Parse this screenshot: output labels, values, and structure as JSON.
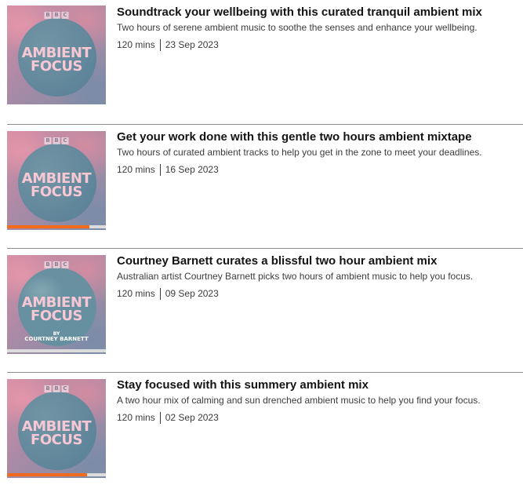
{
  "episodes": [
    {
      "title": "Soundtrack your wellbeing with this curated tranquil ambient mix",
      "description": "Two hours of serene ambient music to soothe the senses and enhance your wellbeing.",
      "duration": "120 mins",
      "date": "23 Sep 2023",
      "art": {
        "logo": [
          "B",
          "B",
          "C"
        ],
        "line1": "AMBIENT",
        "line2": "FOCUS"
      },
      "progress": null
    },
    {
      "title": "Get your work done with this gentle two hours ambient mixtape",
      "description": "Two hours of curated ambient tracks to help you get in the zone to meet your deadlines.",
      "duration": "120 mins",
      "date": "16 Sep 2023",
      "art": {
        "logo": [
          "B",
          "B",
          "C"
        ],
        "line1": "AMBIENT",
        "line2": "FOCUS"
      },
      "progress": 0.83
    },
    {
      "title": "Courtney Barnett curates a blissful two hour ambient mix",
      "description": "Australian artist Courtney Barnett picks two hours of ambient music to help you focus.",
      "duration": "120 mins",
      "date": "09 Sep 2023",
      "art": {
        "logo": [
          "B",
          "B",
          "C"
        ],
        "line1": "AMBIENT",
        "line2": "FOCUS",
        "by": "BY",
        "artist": "COURTNEY BARNETT"
      },
      "progress": 0.0
    },
    {
      "title": "Stay focused with this summery ambient mix",
      "description": "A two hour mix of calming and sun drenched ambient music to help you find your focus.",
      "duration": "120 mins",
      "date": "02 Sep 2023",
      "art": {
        "logo": [
          "B",
          "B",
          "C"
        ],
        "line1": "AMBIENT",
        "line2": "FOCUS"
      },
      "progress": 0.81
    }
  ],
  "colors": {
    "progress_fill": "#f26b1d",
    "progress_track": "#dcdcdc",
    "divider": "#8c8c8c",
    "art_text": "#f7c7d4"
  }
}
